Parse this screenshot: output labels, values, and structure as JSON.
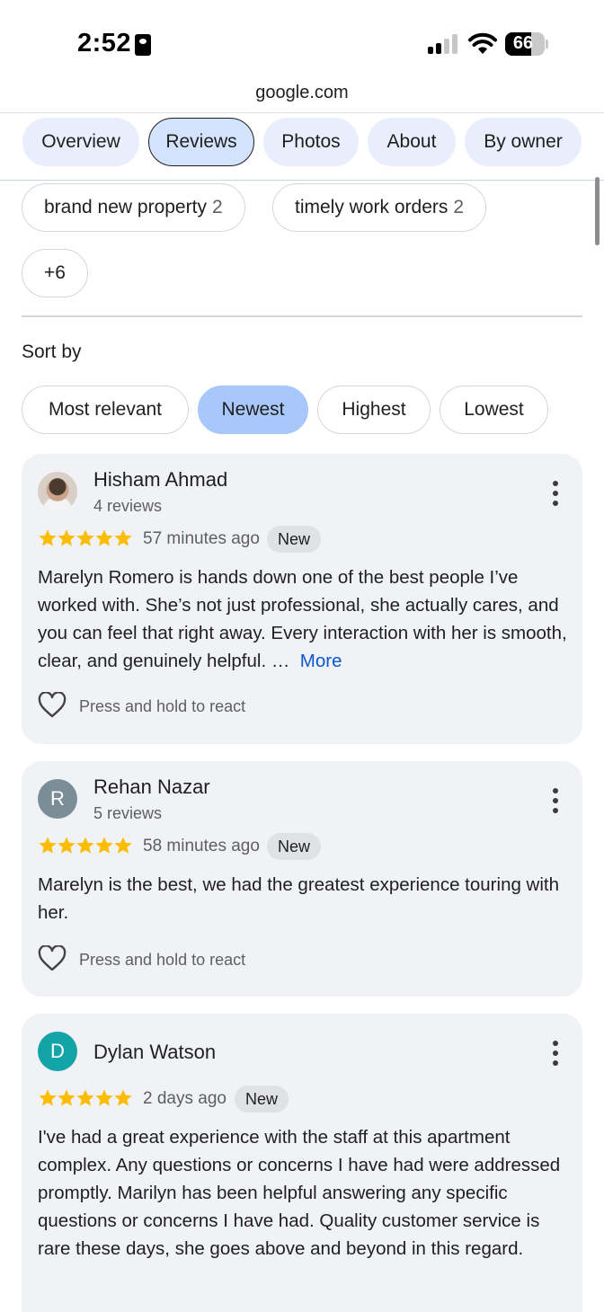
{
  "status_bar": {
    "time": "2:52",
    "battery": "66",
    "battery_level": 0.66
  },
  "browser": {
    "url": "google.com"
  },
  "tabs": [
    {
      "label": "Overview"
    },
    {
      "label": "Reviews",
      "active": true
    },
    {
      "label": "Photos"
    },
    {
      "label": "About"
    },
    {
      "label": "By owner"
    }
  ],
  "topics": [
    {
      "label": "brand new property",
      "count": "2"
    },
    {
      "label": "timely work orders",
      "count": "2"
    },
    {
      "label": "+6"
    }
  ],
  "sort": {
    "label": "Sort by",
    "options": [
      "Most relevant",
      "Newest",
      "Highest",
      "Lowest"
    ],
    "selected": "Newest"
  },
  "reviews": [
    {
      "name": "Hisham Ahmad",
      "review_count": "4 reviews",
      "rating": 5,
      "time_ago": "57 minutes ago",
      "badge": "New",
      "text": "Marelyn Romero is hands down one of the best people I’ve worked with. She’s not just professional, she actually cares, and you can feel that right away. Every interaction with her is smooth, clear, and genuinely helpful. …",
      "more_label": "More",
      "react_hint": "Press and hold to react"
    },
    {
      "name": "Rehan Nazar",
      "initial": "R",
      "review_count": "5 reviews",
      "rating": 5,
      "time_ago": "58 minutes ago",
      "badge": "New",
      "text": "Marelyn is the best, we had the greatest experience touring with her.",
      "react_hint": "Press and hold to react"
    },
    {
      "name": "Dylan Watson",
      "initial": "D",
      "rating": 5,
      "time_ago": "2 days ago",
      "badge": "New",
      "text": "I've had a great experience with the staff at this apartment complex. Any questions or concerns I have had were addressed promptly. Marilyn has been helpful answering any specific questions or concerns I have had. Quality customer service is rare these days, she goes above and beyond in this regard."
    }
  ],
  "colors": {
    "star": "#fbbc04",
    "link": "#0b57d0",
    "selected_chip": "#a8c7fa",
    "tab_bg": "#e8eefc",
    "avatar_rehan": "#7b8e98",
    "avatar_dylan": "#12a4a7"
  }
}
